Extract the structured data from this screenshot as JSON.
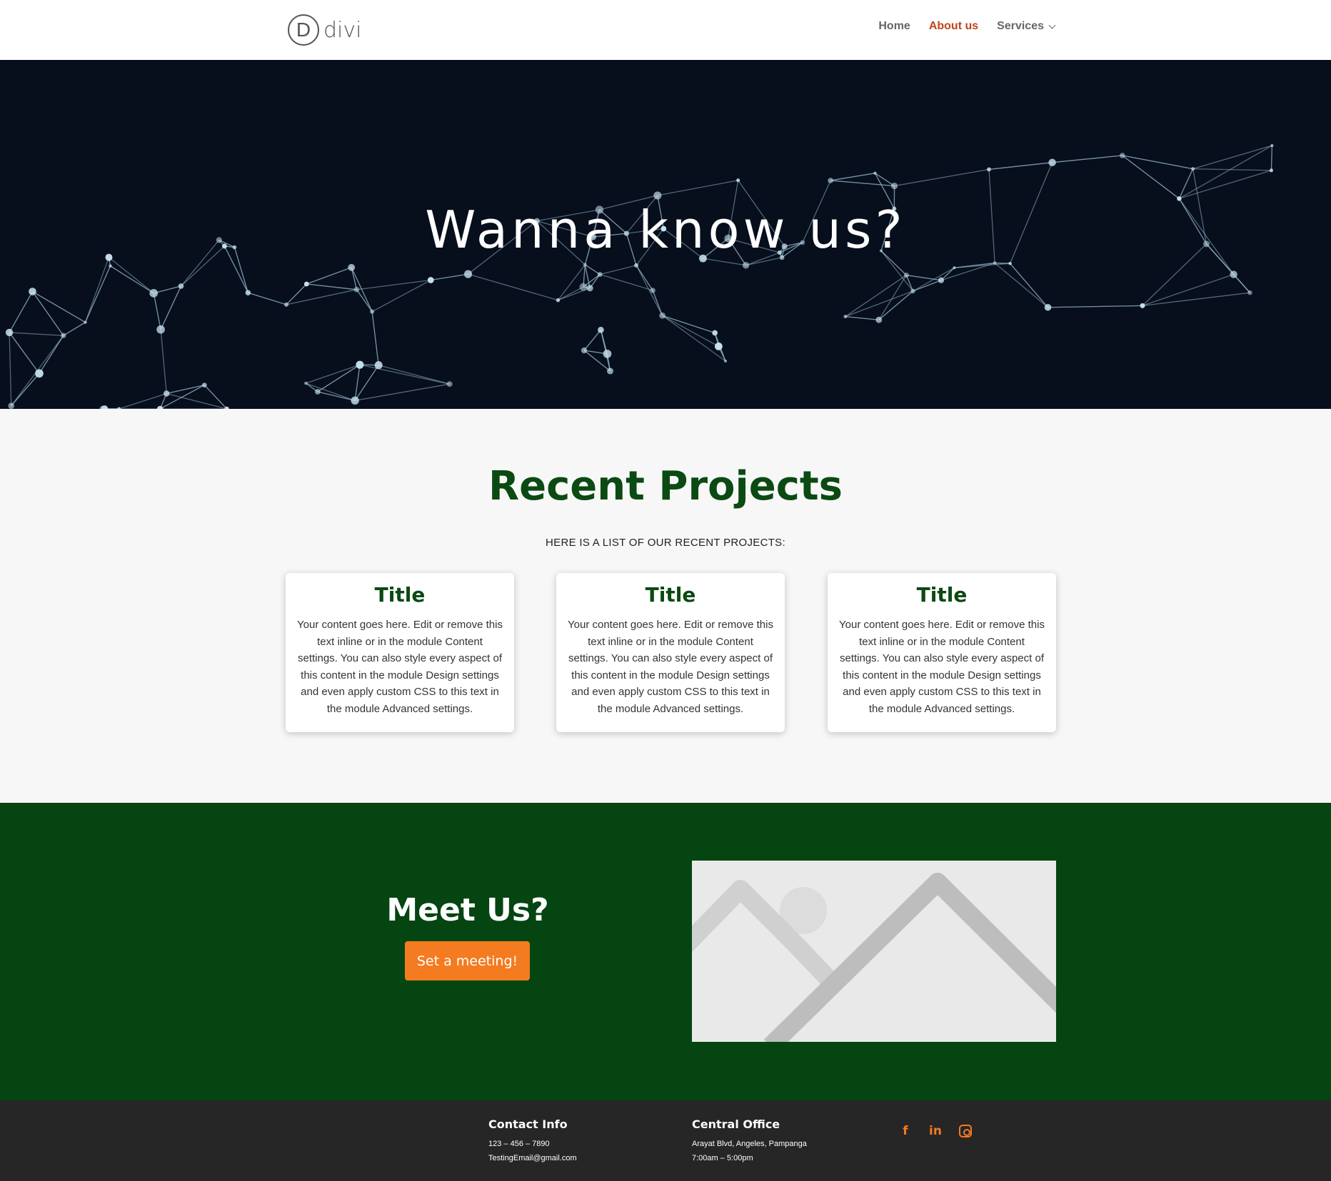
{
  "header": {
    "logo_mark": "D",
    "logo_text": "divi",
    "nav": [
      {
        "label": "Home",
        "active": false
      },
      {
        "label": "About us",
        "active": true
      },
      {
        "label": "Services",
        "active": false,
        "has_dropdown": true
      }
    ],
    "active_color": "#c1441b"
  },
  "hero": {
    "title": "Wanna know us?",
    "background_color": "#070e1c"
  },
  "projects": {
    "title": "Recent Projects",
    "subtitle": "HERE IS A LIST OF OUR RECENT PROJECTS:",
    "cards": [
      {
        "title": "Title",
        "text": "Your content goes here. Edit or remove this text inline or in the module Content settings. You can also style every aspect of this content in the module Design settings and even apply custom CSS to this text in the module Advanced settings."
      },
      {
        "title": "Title",
        "text": "Your content goes here. Edit or remove this text inline or in the module Content settings. You can also style every aspect of this content in the module Design settings and even apply custom CSS to this text in the module Advanced settings."
      },
      {
        "title": "Title",
        "text": "Your content goes here. Edit or remove this text inline or in the module Content settings. You can also style every aspect of this content in the module Design settings and even apply custom CSS to this text in the module Advanced settings."
      }
    ],
    "title_color": "#0b4a12"
  },
  "meet": {
    "title": "Meet Us?",
    "button_label": "Set a meeting!",
    "background_color": "#044511",
    "button_color": "#f47b20",
    "image_icon": "image-placeholder-icon"
  },
  "footer": {
    "contact": {
      "heading": "Contact Info",
      "phone": "123 – 456 – 7890",
      "email": "TestingEmail@gmail.com"
    },
    "office": {
      "heading": "Central Office",
      "address": "Arayat Blvd, Angeles, Pampanga",
      "hours": "7:00am – 5:00pm"
    },
    "social": [
      {
        "icon": "facebook-icon",
        "glyph": "f"
      },
      {
        "icon": "linkedin-icon",
        "glyph": "in"
      },
      {
        "icon": "instagram-icon",
        "glyph": ""
      }
    ],
    "accent_color": "#f47b20"
  }
}
